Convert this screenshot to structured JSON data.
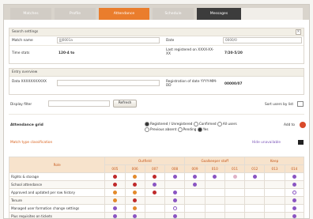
{
  "tabs": [
    {
      "label": "Matches",
      "state": "inactive"
    },
    {
      "label": "Profile",
      "state": "inactive"
    },
    {
      "label": "Attendance",
      "state": "active"
    },
    {
      "label": "Schedule",
      "state": "inactive"
    },
    {
      "label": "Messages",
      "state": "dark"
    }
  ],
  "colors": {
    "accent": "#ea7d2c",
    "link": "#7a54b8",
    "dark_tab": "#3c3c3c"
  },
  "panel1": {
    "header": "Search settings",
    "close_icon": "x-icon",
    "match_name_label": "Match name",
    "match_name_value": "JJJ0001a",
    "date_label": "Date",
    "date_value": "0000/0",
    "time_label": "Time stats",
    "time_value": "120-4 to",
    "extra_label": "Last registered on XXXX-XX-XX",
    "extra_value": "7/20-5/20"
  },
  "panel2": {
    "header": "Entry overview",
    "left_label": "Data XXXXXXXXXXX",
    "right_label": "Registration of date YYYY-MM-DD",
    "right_value": "00000/07"
  },
  "filter": {
    "label": "Display filter",
    "input_value": "",
    "button": "Refresh",
    "toggle_label": "Sort users by list",
    "toggle_icon": "list-icon"
  },
  "attendance": {
    "title": "Attendance grid",
    "radios": [
      {
        "label": "Registered / Unregistered",
        "on": true
      },
      {
        "label": "Confirmed",
        "on": false
      },
      {
        "label": "All users",
        "on": false
      },
      {
        "label": "Previous absent",
        "on": false
      },
      {
        "label": "Pending",
        "on": false
      },
      {
        "label": "Yes",
        "on": true
      }
    ],
    "add_label": "Add to",
    "add_icon": "plus-circle-icon",
    "link": "Match type classification",
    "right_link": "Hide unavailable",
    "right_icon": "square-icon"
  },
  "table": {
    "header": {
      "name_col": "Role",
      "group1": "Outfield",
      "group2": "Goalkeeper staff",
      "group3": "Keep",
      "cols": [
        "005",
        "006",
        "007",
        "008",
        "009",
        "010",
        "011",
        "012",
        "013",
        "014"
      ]
    },
    "rows": [
      {
        "name": "Rights & storage",
        "dots": [
          "red",
          "orange",
          "red",
          "purple",
          "purple",
          "purple",
          "pink",
          "purple",
          "",
          "purple"
        ]
      },
      {
        "name": "School attendance",
        "dots": [
          "red",
          "red",
          "purple",
          "",
          "purple",
          "",
          "",
          "",
          "",
          "purple"
        ]
      },
      {
        "name": "Approved and updated per row history",
        "dots": [
          "orange",
          "orange",
          "red",
          "purple",
          "",
          "",
          "",
          "",
          "",
          "hollow"
        ]
      },
      {
        "name": "Tenure",
        "dots": [
          "orange",
          "red",
          "",
          "purple",
          "",
          "",
          "",
          "",
          "",
          "purple"
        ]
      },
      {
        "name": "Managed user formation change settings",
        "dots": [
          "purple",
          "orange",
          "",
          "hollow",
          "",
          "",
          "",
          "",
          "",
          "purple"
        ]
      },
      {
        "name": "Plus requisites on tickets",
        "dots": [
          "purple",
          "purple",
          "",
          "purple",
          "",
          "",
          "",
          "",
          "",
          "purple"
        ]
      }
    ]
  }
}
